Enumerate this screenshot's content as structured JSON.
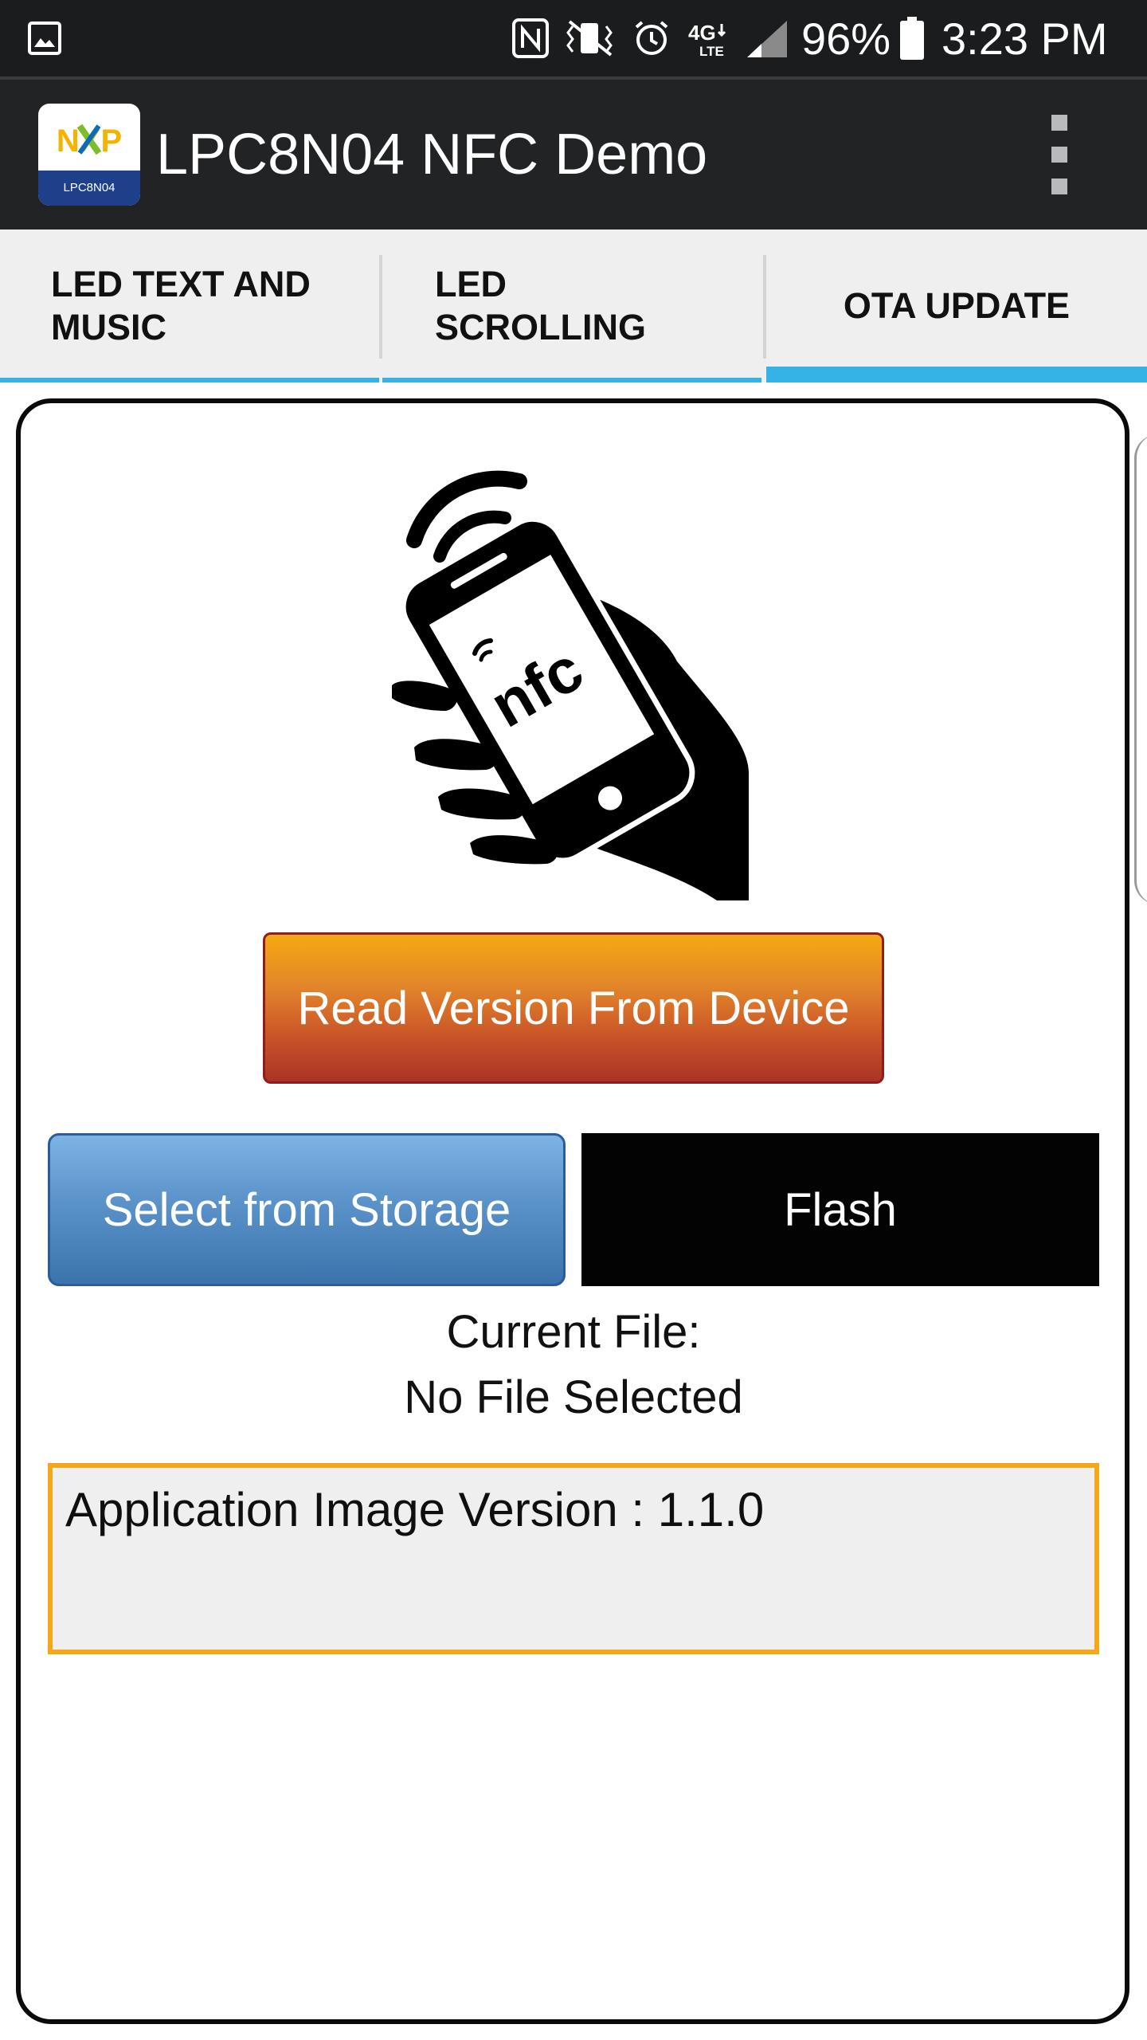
{
  "status_bar": {
    "battery_percent": "96%",
    "time": "3:23 PM",
    "network": "4G LTE",
    "icons": [
      "gallery-icon",
      "nfc-icon",
      "vibrate-icon",
      "alarm-icon",
      "lte-icon",
      "signal-icon",
      "battery-icon"
    ],
    "battery_level": 0.96
  },
  "app_bar": {
    "title": "LPC8N04 NFC Demo",
    "logo": {
      "brand": "NXP",
      "caption": "LPC8N04"
    },
    "menu_icon": "overflow-menu-icon"
  },
  "tabs": [
    {
      "label": "LED TEXT AND MUSIC",
      "line1": "LED TEXT AND",
      "line2": "MUSIC",
      "selected": false
    },
    {
      "label": "LED SCROLLING",
      "line1": "LED",
      "line2": "SCROLLING",
      "selected": false
    },
    {
      "label": "OTA UPDATE",
      "line1": "OTA UPDATE",
      "line2": "",
      "selected": true
    }
  ],
  "main": {
    "illustration": {
      "icon": "nfc-hand-phone-icon",
      "text": "nfc"
    },
    "read_version_button": "Read Version From Device",
    "select_storage_button": "Select from Storage",
    "flash_button": "Flash",
    "current_file_label": "Current File:",
    "current_file_value": "No File Selected",
    "version_text": "Application Image Version : 1.1.0"
  },
  "colors": {
    "status_bar_bg": "#1b1c1e",
    "action_bar_bg": "#222325",
    "tab_bg": "#efefef",
    "tab_indicator": "#35b3e6",
    "read_button_top": "#f5aa12",
    "read_button_bottom": "#aa3326",
    "select_button_top": "#7db4e5",
    "select_button_bottom": "#3b73ac",
    "flash_button": "#030303",
    "version_border": "#f4a718",
    "version_bg": "#efeff0"
  }
}
